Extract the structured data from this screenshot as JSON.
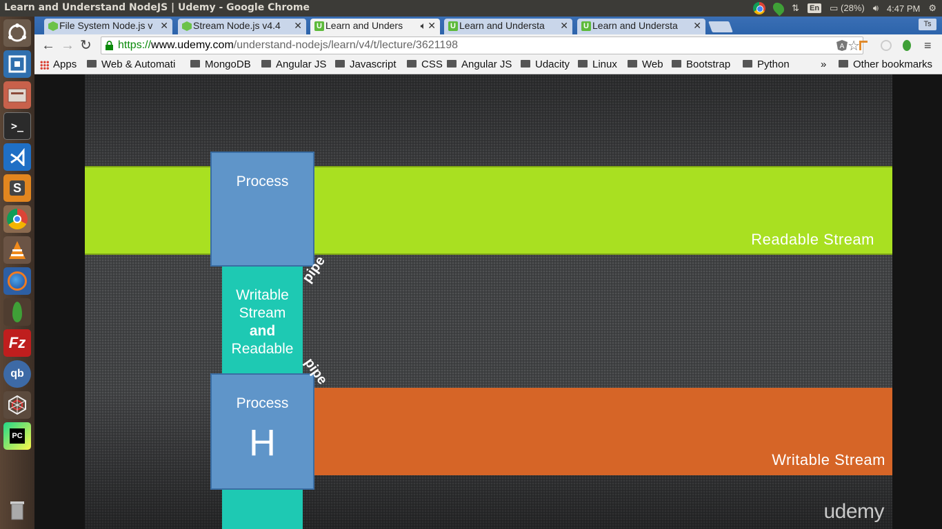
{
  "os": {
    "window_title": "Learn and Understand NodeJS | Udemy - Google Chrome",
    "keyboard": "En",
    "battery": "(28%)",
    "time": "4:47 PM"
  },
  "launcher": {
    "items": [
      "ubuntu-dash-icon",
      "system-monitor-icon",
      "files-icon",
      "terminal-icon",
      "vscode-icon",
      "sublime-text-icon",
      "chrome-icon",
      "vlc-icon",
      "firefox-icon",
      "mongodb-icon",
      "filezilla-icon",
      "qbittorrent-icon",
      "spider-web-icon",
      "pycharm-icon",
      "trash-icon"
    ]
  },
  "tabs": [
    {
      "label": "File System Node.js v",
      "icon": "node-icon"
    },
    {
      "label": "Stream Node.js v4.4",
      "icon": "node-icon"
    },
    {
      "label": "Learn and Unders",
      "icon": "udemy-icon",
      "active": true
    },
    {
      "label": "Learn and Understa",
      "icon": "udemy-icon"
    },
    {
      "label": "Learn and Understa",
      "icon": "udemy-icon"
    }
  ],
  "profile_label": "Ts",
  "omnibox": {
    "scheme": "https://",
    "host": "www.udemy.com",
    "path": "/understand-nodejs/learn/v4/t/lecture/3621198"
  },
  "bookmarks": {
    "apps": "Apps",
    "items": [
      "Web & Automati",
      "MongoDB",
      "Angular JS",
      "Javascript",
      "CSS",
      "Angular JS",
      "Udacity",
      "Linux",
      "Web",
      "Bootstrap",
      "Python"
    ],
    "overflow": "»",
    "other": "Other bookmarks"
  },
  "slide": {
    "readable_label": "Readable Stream",
    "writable_label": "Writable Stream",
    "process_top": "Process",
    "middle_lines": [
      "Writable",
      "Stream",
      "and",
      "Readable"
    ],
    "pipe_top": "pipe",
    "pipe_bottom": "pipe",
    "process_bottom": "Process",
    "process_bottom_letter": "H",
    "watermark": "udemy"
  },
  "colors": {
    "readable": "#a9e021",
    "writable": "#d66527",
    "process": "#5f95c9",
    "teal": "#1ec9b3"
  }
}
